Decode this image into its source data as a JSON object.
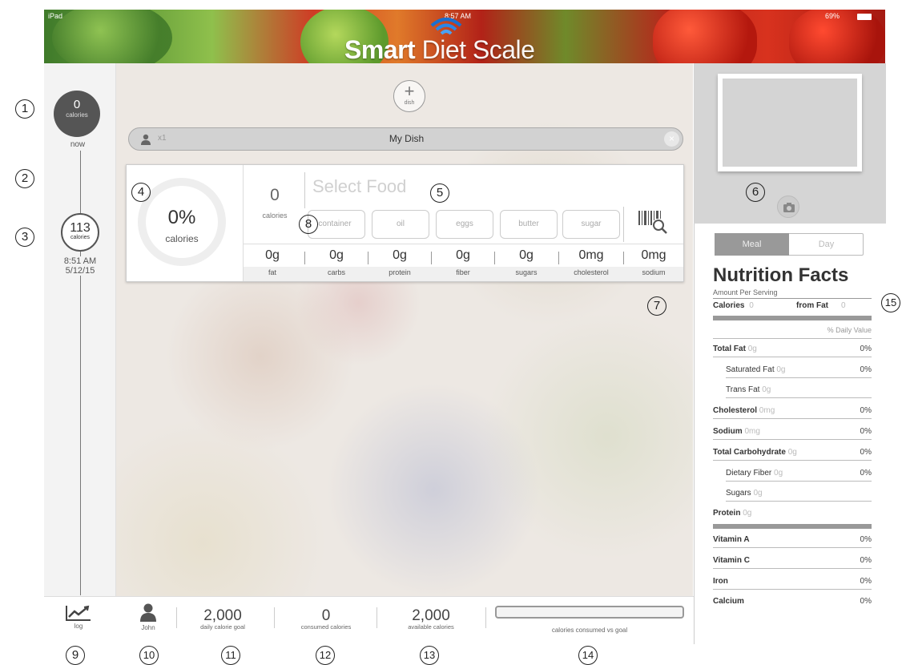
{
  "status": {
    "device": "iPad",
    "time": "8:57 AM",
    "battery": "69%"
  },
  "app": {
    "logo_bold": "Smart",
    "logo_light": "Diet Scale"
  },
  "timeline": {
    "now_value": "0",
    "now_unit": "calories",
    "now_label": "now",
    "entry_value": "113",
    "entry_unit": "calories",
    "entry_time": "8:51 AM",
    "entry_date": "5/12/15"
  },
  "dish": {
    "add_label": "dish",
    "servings": "x1",
    "name": "My Dish",
    "percent": "0%",
    "percent_label": "calories",
    "calories": "0",
    "calories_label": "calories",
    "select_placeholder": "Select Food",
    "food_chips": [
      "container",
      "oil",
      "eggs",
      "butter",
      "sugar"
    ],
    "nutrients": [
      {
        "value": "0g",
        "label": "fat"
      },
      {
        "value": "0g",
        "label": "carbs"
      },
      {
        "value": "0g",
        "label": "protein"
      },
      {
        "value": "0g",
        "label": "fiber"
      },
      {
        "value": "0g",
        "label": "sugars"
      },
      {
        "value": "0mg",
        "label": "cholesterol"
      },
      {
        "value": "0mg",
        "label": "sodium"
      }
    ]
  },
  "nutrition": {
    "tab_meal": "Meal",
    "tab_day": "Day",
    "title": "Nutrition Facts",
    "subtitle": "Amount Per Serving",
    "calories_label": "Calories",
    "calories_value": "0",
    "from_fat_label": "from Fat",
    "from_fat_value": "0",
    "daily_value_header": "% Daily Value",
    "rows": [
      {
        "label": "Total Fat",
        "amount": "0g",
        "pct": "0%"
      },
      {
        "label": "Saturated Fat",
        "amount": "0g",
        "pct": "0%"
      },
      {
        "label": "Trans Fat",
        "amount": "0g",
        "pct": ""
      },
      {
        "label": "Cholesterol",
        "amount": "0mg",
        "pct": "0%"
      },
      {
        "label": "Sodium",
        "amount": "0mg",
        "pct": "0%"
      },
      {
        "label": "Total Carbohydrate",
        "amount": "0g",
        "pct": "0%"
      },
      {
        "label": "Dietary Fiber",
        "amount": "0g",
        "pct": "0%"
      },
      {
        "label": "Sugars",
        "amount": "0g",
        "pct": ""
      },
      {
        "label": "Protein",
        "amount": "0g",
        "pct": ""
      }
    ],
    "vitamins": [
      {
        "label": "Vitamin A",
        "pct": "0%"
      },
      {
        "label": "Vitamin C",
        "pct": "0%"
      },
      {
        "label": "Iron",
        "pct": "0%"
      },
      {
        "label": "Calcium",
        "pct": "0%"
      }
    ]
  },
  "bottom": {
    "log_label": "log",
    "user_name": "John",
    "goal_value": "2,000",
    "goal_label": "daily calorie goal",
    "consumed_value": "0",
    "consumed_label": "consumed calories",
    "available_value": "2,000",
    "available_label": "available calories",
    "progress_label": "calories consumed vs goal",
    "progress_fraction": 0
  },
  "callouts": [
    "1",
    "2",
    "3",
    "4",
    "5",
    "6",
    "7",
    "8",
    "9",
    "10",
    "11",
    "12",
    "13",
    "14",
    "15"
  ]
}
